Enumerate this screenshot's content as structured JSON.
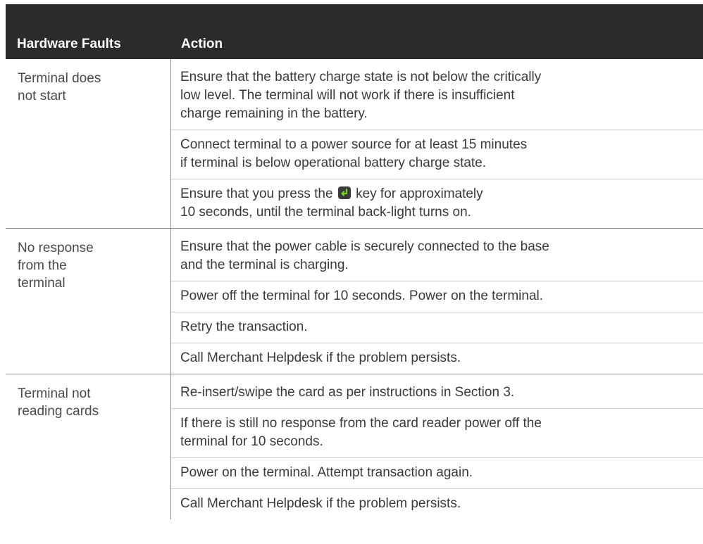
{
  "header": {
    "col1": "Hardware Faults",
    "col2": "Action"
  },
  "rows": [
    {
      "fault": "Terminal does\nnot start",
      "actions": [
        "Ensure that the battery charge state is not below the critically\nlow level. The terminal will not work if there is insufficient\ncharge remaining in the battery.",
        "Connect terminal to a power source for at least 15 minutes\nif terminal is below operational battery charge state.",
        {
          "before": "Ensure that you press the",
          "icon": "enter-key-icon",
          "after": "key for approximately\n10 seconds, until the terminal back-light turns on."
        }
      ]
    },
    {
      "fault": "No response\nfrom the\nterminal",
      "actions": [
        "Ensure that the power cable is securely connected to the base\nand the terminal is charging.",
        "Power off the terminal for 10 seconds. Power on the terminal.",
        "Retry the transaction.",
        "Call Merchant Helpdesk if the problem persists."
      ]
    },
    {
      "fault": "Terminal not\nreading cards",
      "actions": [
        "Re-insert/swipe the card as per instructions in Section 3.",
        "If there is still no response from the card reader power off the\nterminal for 10 seconds.",
        "Power on the terminal. Attempt transaction again.",
        "Call Merchant Helpdesk if the problem persists."
      ]
    }
  ],
  "colors": {
    "header_bg": "#2b2b2b",
    "header_text": "#ffffff",
    "enter_key_bg": "#3b3b3b",
    "enter_key_arrow": "#7ed321"
  }
}
